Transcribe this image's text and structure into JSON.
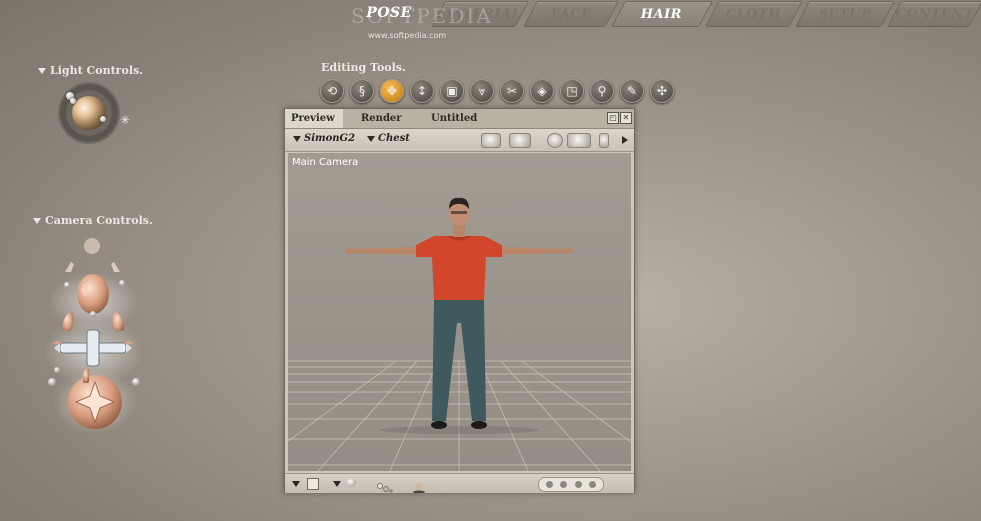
{
  "tabs": [
    {
      "label": "POSE",
      "active": true
    },
    {
      "label": "MATERIAL",
      "active": false
    },
    {
      "label": "FACE",
      "active": false
    },
    {
      "label": "HAIR",
      "active": true
    },
    {
      "label": "CLOTH",
      "active": false
    },
    {
      "label": "SETUP",
      "active": false
    },
    {
      "label": "CONTENT",
      "active": false
    }
  ],
  "watermark": {
    "text": "SOFTPEDIA",
    "url": "www.softpedia.com"
  },
  "light_controls": {
    "title": "Light Controls."
  },
  "camera_controls": {
    "title": "Camera Controls."
  },
  "editing_tools": {
    "title": "Editing Tools.",
    "tools": [
      {
        "icon": "rotate-icon",
        "active": false
      },
      {
        "icon": "twist-icon",
        "active": false
      },
      {
        "icon": "translate-icon",
        "active": true
      },
      {
        "icon": "translate-in-out-icon",
        "active": false
      },
      {
        "icon": "scale-icon",
        "active": false
      },
      {
        "icon": "taper-icon",
        "active": false
      },
      {
        "icon": "chain-break-icon",
        "active": false
      },
      {
        "icon": "color-icon",
        "active": false
      },
      {
        "icon": "grouping-icon",
        "active": false
      },
      {
        "icon": "view-magnifier-icon",
        "active": false
      },
      {
        "icon": "morphing-tool-icon",
        "active": false
      },
      {
        "icon": "direct-manipulation-icon",
        "active": false
      }
    ]
  },
  "document_window": {
    "tabs": [
      {
        "label": "Preview",
        "active": true
      },
      {
        "label": "Render",
        "active": false
      },
      {
        "label": "Untitled",
        "active": false
      }
    ],
    "figure_select": "SimonG2",
    "actor_select": "Chest",
    "camera_label": "Main Camera"
  },
  "colors": {
    "accent": "#d68a1b",
    "shirt": "#d2462c",
    "jeans": "#3f5a5e"
  }
}
